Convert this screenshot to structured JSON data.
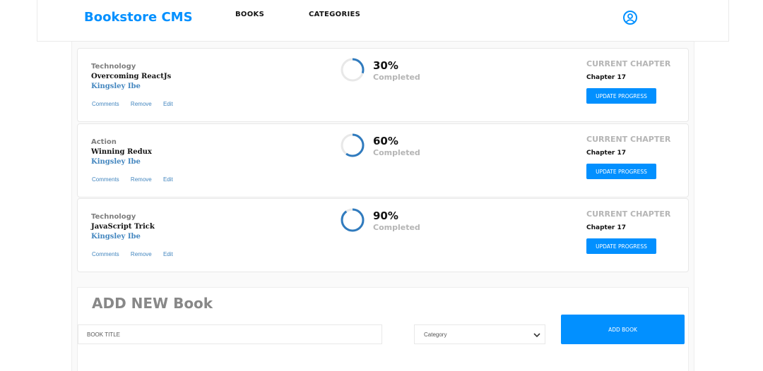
{
  "header": {
    "logo": "Bookstore CMS",
    "nav": [
      {
        "label": "BOOKS"
      },
      {
        "label": "CATEGORIES"
      }
    ],
    "user_icon": "user-circle-icon",
    "accent_color": "#0290ff"
  },
  "books": [
    {
      "category": "Technology",
      "title": "Overcoming ReactJs",
      "author": "Kingsley Ibe",
      "actions": [
        "Comments",
        "Remove",
        "Edit"
      ],
      "progress_percent": 30,
      "percent_label": "30%",
      "completed_label": "Completed",
      "chapter_label": "CURRENT CHAPTER",
      "chapter": "Chapter 17",
      "update_label": "UPDATE PROGRESS"
    },
    {
      "category": "Action",
      "title": "Winning Redux",
      "author": "Kingsley Ibe",
      "actions": [
        "Comments",
        "Remove",
        "Edit"
      ],
      "progress_percent": 60,
      "percent_label": "60%",
      "completed_label": "Completed",
      "chapter_label": "CURRENT CHAPTER",
      "chapter": "Chapter 17",
      "update_label": "UPDATE PROGRESS"
    },
    {
      "category": "Technology",
      "title": "JavaScript Trick",
      "author": "Kingsley Ibe",
      "actions": [
        "Comments",
        "Remove",
        "Edit"
      ],
      "progress_percent": 90,
      "percent_label": "90%",
      "completed_label": "Completed",
      "chapter_label": "CURRENT CHAPTER",
      "chapter": "Chapter 17",
      "update_label": "UPDATE PROGRESS"
    }
  ],
  "add_form": {
    "heading": "ADD NEW Book",
    "title_placeholder": "BOOK TITLE",
    "category_selected": "Category",
    "submit_label": "ADD BOOK"
  },
  "colors": {
    "progress_ring": "#307bbe",
    "ring_track": "#e8e8e8",
    "link": "#4386bf"
  }
}
